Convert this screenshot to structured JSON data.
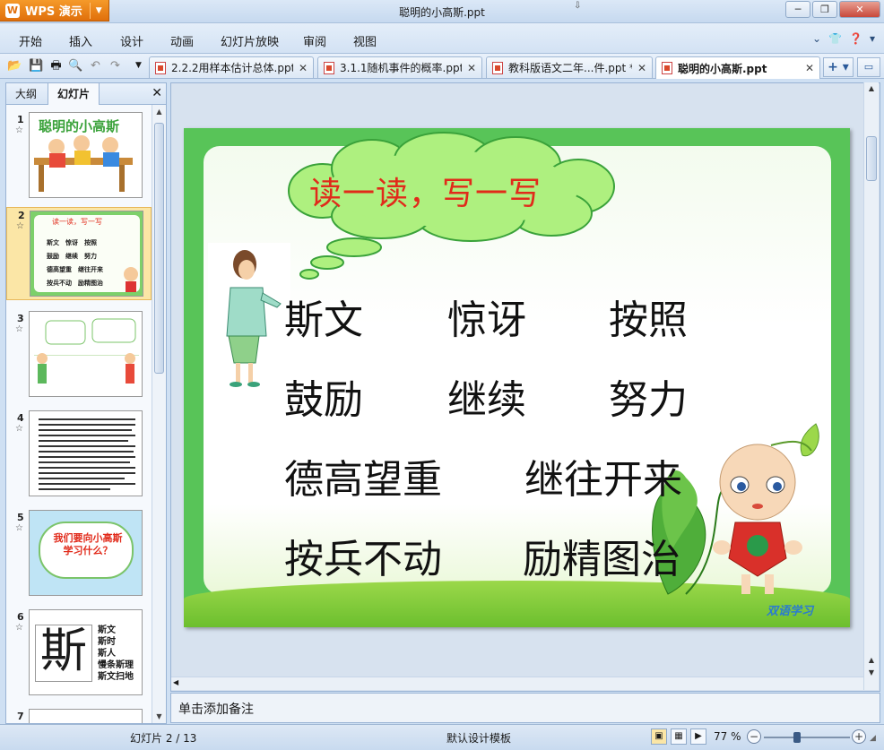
{
  "titlebar": {
    "app_button": "WPS 演示",
    "document_title": "聪明的小高斯.ppt",
    "minimize": "─",
    "restore": "❐",
    "close": "✕"
  },
  "menu": {
    "items": [
      "开始",
      "插入",
      "设计",
      "动画",
      "幻灯片放映",
      "审阅",
      "视图"
    ]
  },
  "tabs": [
    {
      "label": "2.2.2用样本估计总体.ppt *",
      "close": "✕"
    },
    {
      "label": "3.1.1随机事件的概率.ppt",
      "close": "✕"
    },
    {
      "label": "教科版语文二年...件.ppt *",
      "close": "✕"
    },
    {
      "label": "聪明的小高斯.ppt",
      "close": "✕"
    }
  ],
  "left_panel": {
    "tab_outline": "大纲",
    "tab_slides": "幻灯片",
    "close": "✕",
    "thumbnails": [
      {
        "num": "1",
        "text": "聪明的小高斯"
      },
      {
        "num": "2",
        "text": "读一读，写一写"
      },
      {
        "num": "3",
        "text": ""
      },
      {
        "num": "4",
        "text": ""
      },
      {
        "num": "5",
        "text": "我们要向小高斯学习什么？"
      },
      {
        "num": "6",
        "text": "斯"
      },
      {
        "num": "7",
        "text": ""
      }
    ],
    "thumb6_words": [
      "斯文",
      "斯时",
      "斯人",
      "慢条斯理",
      "斯文扫地"
    ],
    "thumb2_words": [
      "斯文",
      "惊讶",
      "按照",
      "鼓励",
      "继续",
      "努力",
      "德高望重",
      "继往开来",
      "按兵不动",
      "励精图治"
    ]
  },
  "slide": {
    "heading": "读一读，写一写",
    "words": [
      "斯文",
      "惊讶",
      "按照",
      "鼓励",
      "继续",
      "努力",
      "德高望重",
      "继往开来",
      "按兵不动",
      "励精图治"
    ],
    "brand": "双语学习"
  },
  "notes": {
    "placeholder": "单击添加备注"
  },
  "status": {
    "slide_counter": "幻灯片 2 / 13",
    "template": "默认设计模板",
    "zoom": "77 %",
    "zoom_level": 0.77
  },
  "colors": {
    "heading_red": "#e12a1a",
    "slide_green": "#58c458",
    "wps_orange": "#e06f0b"
  }
}
